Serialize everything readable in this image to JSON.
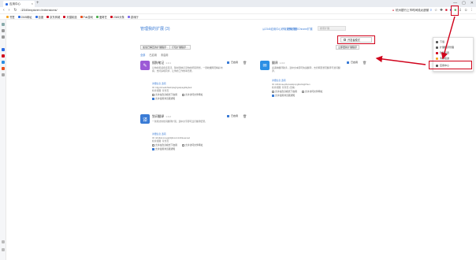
{
  "window": {
    "tab_title": "应用中心",
    "new_tab": "+",
    "controls": [
      "—",
      "▢",
      "✕"
    ]
  },
  "address": {
    "url": "2345explorer://extensions/",
    "right_text": "杭州银行上市时间线太遗憾"
  },
  "bookmarks": [
    {
      "label": "书签",
      "color": "#f5a623"
    },
    {
      "label": "2345网址",
      "color": "#2b6be4"
    },
    {
      "label": "百度",
      "color": "#2b6be4"
    },
    {
      "label": "京东商城",
      "color": "#d0021b"
    },
    {
      "label": "天猫精选",
      "color": "#d0021b"
    },
    {
      "label": "Pub游戏",
      "color": "#e94e1b"
    },
    {
      "label": "爱奇艺",
      "color": "#4caf50"
    },
    {
      "label": "2345头条",
      "color": "#d0021b"
    },
    {
      "label": "游戏厅",
      "color": "#7b68ee"
    }
  ],
  "page": {
    "title": "管理我的扩展 (3)",
    "link1": "从2345应用中心获取更多扩展",
    "link2": "获取更多Chrome扩展",
    "search_placeholder": "搜索扩展",
    "dev_mode_label": "开发者模式",
    "btn_load": "加载已解压的扩展程序...",
    "btn_pack": "打包扩展程序...",
    "btn_update": "立即更新扩展程序",
    "filters": [
      "全部",
      "已启用",
      "未启用"
    ]
  },
  "cards": [
    {
      "name": "搜狗笔记",
      "version": "1.0.1",
      "desc": "让你的灵感永远存活，随时随地记录你的所思所想，一键收藏网页精彩内容，支持多端同步，让你的工作效率倍增。",
      "enabled_label": "已启用",
      "detail_label": "详细信息",
      "options_label": "选项",
      "id_text": "ID: bfgpnbnekkhkahpiaghgakpagklkgbek",
      "view_text": "检查视图: 背景页",
      "opt1": "允许在隐身模式下启用",
      "opt2": "允许访问文件网址",
      "opt3": "允许使用浏览器通知",
      "icon_color": "#9c5ad6",
      "icon_char": "✎"
    },
    {
      "name": "翻译",
      "version": "1.0.0",
      "desc": "多语种翻译助手，选中文本即可快速翻译，支持网页整页翻译与划词翻译。",
      "enabled_label": "已启用",
      "detail_label": "详细信息",
      "options_label": "选项",
      "id_text": "ID: kbfnbcaeplbcioakkpcpgfkobkghlhen",
      "view_text": "检查视图: 背景页 (无效)",
      "opt1": "允许在隐身模式下启用",
      "opt2": "允许访问文件网址",
      "opt3": "允许使用浏览器通知",
      "icon_color": "#2b8fe4",
      "icon_char": "✉"
    },
    {
      "name": "划词翻译",
      "version": "1.0.2",
      "desc": "一款简洁的划词翻译扩展，选中文字即可显示翻译结果。",
      "enabled_label": "已启用",
      "detail_label": "详细信息",
      "options_label": "选项",
      "id_text": "ID: ikhdkkncnoglghljlkmcimlnlhkeamad",
      "view_text": "检查视图: 背景页",
      "opt1": "允许在隐身模式下启用",
      "opt2": "允许访问文件网址",
      "opt3": "允许使用浏览器通知",
      "icon_color": "#3a7bd5",
      "icon_char": "译"
    }
  ],
  "menu": {
    "items": [
      {
        "label": "下载",
        "color": "#555"
      },
      {
        "label": "扩展程序管理",
        "color": "#555"
      },
      {
        "label": "隐私设置",
        "color": "#d0021b"
      },
      {
        "label": "清除痕迹",
        "color": "#f5a623"
      },
      {
        "label": "应用中心",
        "color": "#555"
      }
    ]
  },
  "colors": {
    "accent": "#3a7bd5",
    "highlight": "#d0021b"
  }
}
